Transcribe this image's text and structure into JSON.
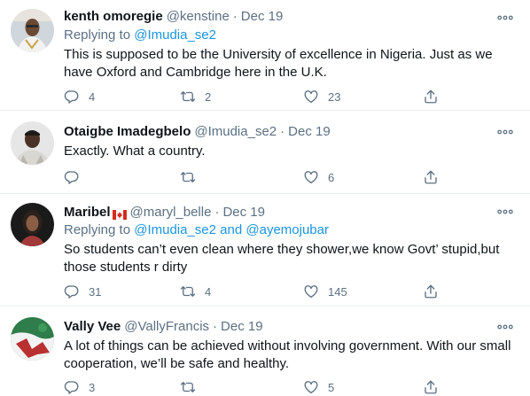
{
  "colors": {
    "secondary": "#5b7083",
    "link": "#1b95e0",
    "divider": "#ebeef0",
    "text": "#0f1419"
  },
  "tweets": [
    {
      "name": "kenth omoregie",
      "handle": "@kenstine",
      "separator": "·",
      "date": "Dec 19",
      "replying_prefix": "Replying to ",
      "replying_to": "@Imudia_se2",
      "replying_and": "",
      "replying_to_2": "",
      "text": "This is supposed to be the University of excellence in Nigeria. Just as we have Oxford and Cambridge here in the U.K.",
      "replies": "4",
      "retweets": "2",
      "likes": "23"
    },
    {
      "name": "Otaigbe Imadegbelo",
      "handle": "@Imudia_se2",
      "separator": "·",
      "date": "Dec 19",
      "text": "Exactly. What a country.",
      "replies": "",
      "retweets": "",
      "likes": "6"
    },
    {
      "name": "Maribel",
      "flag_icon": "canada-flag-icon",
      "handle": "@maryl_belle",
      "separator": "·",
      "date": "Dec 19",
      "replying_prefix": "Replying to ",
      "replying_to": "@Imudia_se2",
      "replying_and": " and ",
      "replying_to_2": "@ayemojubar",
      "text": "So students can’t even clean where they shower,we know Govt’ stupid,but those students r dirty",
      "replies": "31",
      "retweets": "4",
      "likes": "145"
    },
    {
      "name": "Vally Vee",
      "handle": "@VallyFrancis",
      "separator": "·",
      "date": "Dec 19",
      "text": "A lot of things can be achieved without involving government. With our small cooperation, we’ll be safe and healthy.",
      "replies": "3",
      "retweets": "",
      "likes": "5"
    }
  ]
}
